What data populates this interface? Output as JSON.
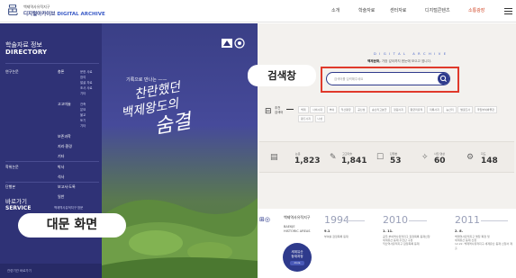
{
  "header": {
    "logo_small": "백제역사유적지구",
    "logo_big_kr": "디지털아카이브",
    "logo_big_en": "DIGITAL ARCHIVE",
    "nav": [
      "소개",
      "학술자료",
      "센터자료",
      "디지털콘텐츠",
      "소통광장"
    ]
  },
  "sidebar": {
    "title": "학술자료 정보",
    "subtitle": "DIRECTORY",
    "sections": [
      {
        "label": "연구논문",
        "sub": "총론",
        "items": [
          "문헌 사료",
          "참여",
          "발굴 자료",
          "조사 사료",
          "기타"
        ]
      },
      {
        "label": "",
        "sub": "고고미술",
        "items": [
          "건축",
          "분묘",
          "불교",
          "토기",
          "기타"
        ]
      },
      {
        "label": "",
        "sub": "보존과학",
        "items": []
      },
      {
        "label": "",
        "sub": "지리·환경",
        "items": []
      },
      {
        "label": "",
        "sub": "기타",
        "items": []
      },
      {
        "label": "학위논문",
        "sub": "박사",
        "items": []
      },
      {
        "label": "",
        "sub": "석사",
        "items": []
      },
      {
        "label": "단행본",
        "sub": "보고서·도록",
        "items": []
      },
      {
        "label": "",
        "sub": "일반",
        "items": []
      }
    ],
    "visit_title": "바로가기",
    "visit_sub": "SERVICE",
    "visit_text": "백제역사유적지구 방문",
    "bottom_text": "관련기관 바로가기"
  },
  "poster": {
    "small": "기록으로 만나는 ——",
    "title_line1": "찬란했던",
    "title_line2": "백제왕도의",
    "title_line3": "숨결"
  },
  "main": {
    "da_title": "DIGITAL ARCHIVE",
    "da_sub_bold": "백제문화,",
    "da_sub": " 가장 깊이까지 한눈에 모으고 엽니다.",
    "search_placeholder": "검색어를 입력해주세요",
    "search_callout": "검색창",
    "bookmark_label": "추천\n검색어",
    "tags": [
      "백제",
      "사비시대",
      "부여",
      "익산왕궁",
      "공산성",
      "송산리고분군",
      "정림사지",
      "왕궁리유적",
      "미륵사지",
      "능산리",
      "발굴조사",
      "국립부여박물관",
      "왕흥사지",
      "나성"
    ],
    "stats": [
      {
        "icon": "document-icon",
        "label": "논문",
        "value": "1,823"
      },
      {
        "icon": "scroll-icon",
        "label": "고고미술",
        "value": "1,841"
      },
      {
        "icon": "book-icon",
        "label": "단행본",
        "value": "53"
      },
      {
        "icon": "photo-icon",
        "label": "사진·영상",
        "value": "60"
      },
      {
        "icon": "map-icon",
        "label": "지도",
        "value": "148"
      }
    ]
  },
  "timeline": {
    "org": "백제역사유적지구",
    "org_en": "BAEKJE\nHISTORIC AREAS",
    "circle_text": "세계유산\n등재과정",
    "circle_btn": "more",
    "years": [
      "1994",
      "2010",
      "2011"
    ],
    "events": [
      {
        "date": "9.1",
        "text": "부여를 잠정목록 등재"
      },
      {
        "date": "1. 11.",
        "text": "공주·부여역사유적지구 잠정목록 등재신청\n세계유산 등재 추진단 구성\n익산역사유적지구 잠정목록 등재"
      },
      {
        "date": "2. 8.",
        "text": "백제역사유적지구 명칭 확정 및\n세계유산 등재 신청\n12.22. 백제역사유적지구 세계유산 등재 신청서 제출"
      }
    ]
  },
  "callouts": {
    "bottom_label": "대문 화면"
  },
  "colors": {
    "navy": "#2f3276",
    "accent_blue": "#2e3a8c",
    "highlight_red": "#e0392b",
    "bg_main": "#f3f1ee"
  }
}
